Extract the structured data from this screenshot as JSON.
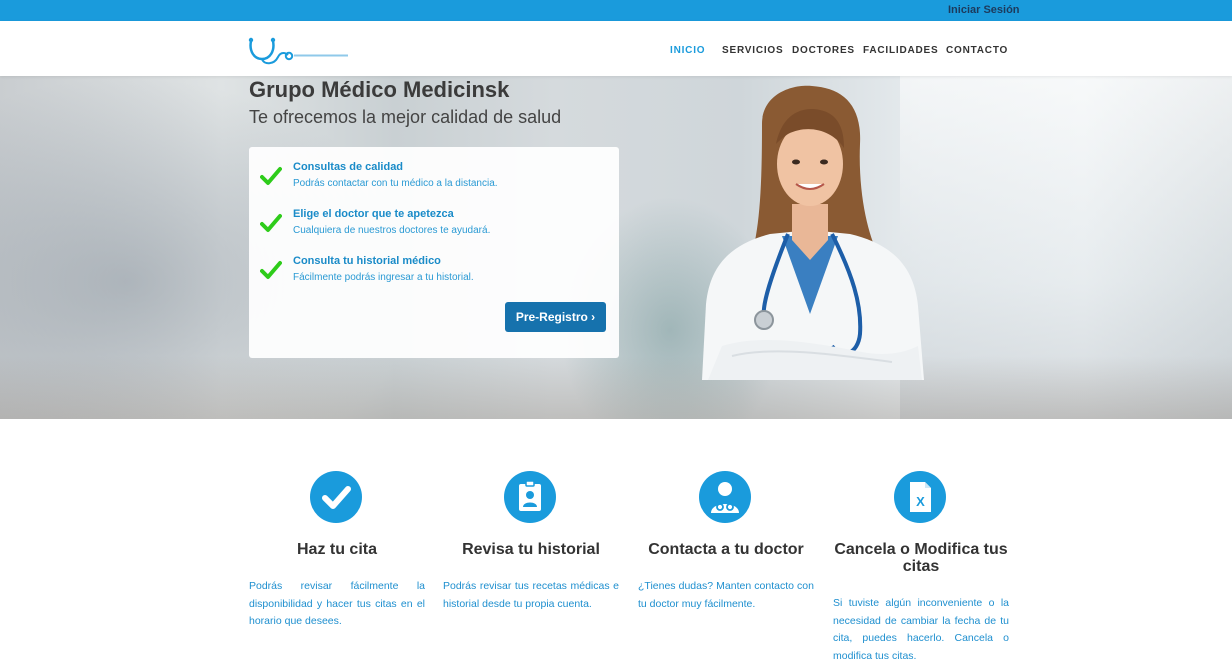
{
  "topbar": {
    "login": "Iniciar Sesión"
  },
  "nav": {
    "items": [
      "INICIO",
      "SERVICIOS",
      "DOCTORES",
      "FACILIDADES",
      "CONTACTO"
    ],
    "active_color": "#1a9bdc"
  },
  "hero": {
    "title": "Grupo Médico Medicinsk",
    "subtitle": "Te ofrecemos la mejor calidad de salud",
    "features": [
      {
        "title": "Consultas de calidad",
        "desc": "Podrás contactar con tu médico a la distancia."
      },
      {
        "title": "Elige el doctor que te apetezca",
        "desc": "Cualquiera de nuestros doctores te ayudará."
      },
      {
        "title": "Consulta tu historial médico",
        "desc": "Fácilmente podrás ingresar a tu historial."
      }
    ],
    "cta": "Pre-Registro ›"
  },
  "services": [
    {
      "icon": "check-icon",
      "title": "Haz tu cita",
      "desc": "Podrás revisar fácilmente la disponibilidad y hacer tus citas en el horario que desees."
    },
    {
      "icon": "id-card-icon",
      "title": "Revisa tu historial",
      "desc": "Podrás revisar tus recetas médicas e historial desde tu propia cuenta."
    },
    {
      "icon": "doctor-icon",
      "title": "Contacta a tu doctor",
      "desc": "¿Tienes dudas? Manten contacto con tu doctor muy fácilmente."
    },
    {
      "icon": "excel-file-icon",
      "title": "Cancela o Modifica tus citas",
      "desc": "Si tuviste algún inconveniente o la necesidad de cambiar la fecha de tu cita, puedes hacerlo. Cancela o modifica tus citas."
    }
  ],
  "colors": {
    "brand": "#1a9bdc",
    "button": "#1672ad",
    "check": "#2ecc1a"
  }
}
